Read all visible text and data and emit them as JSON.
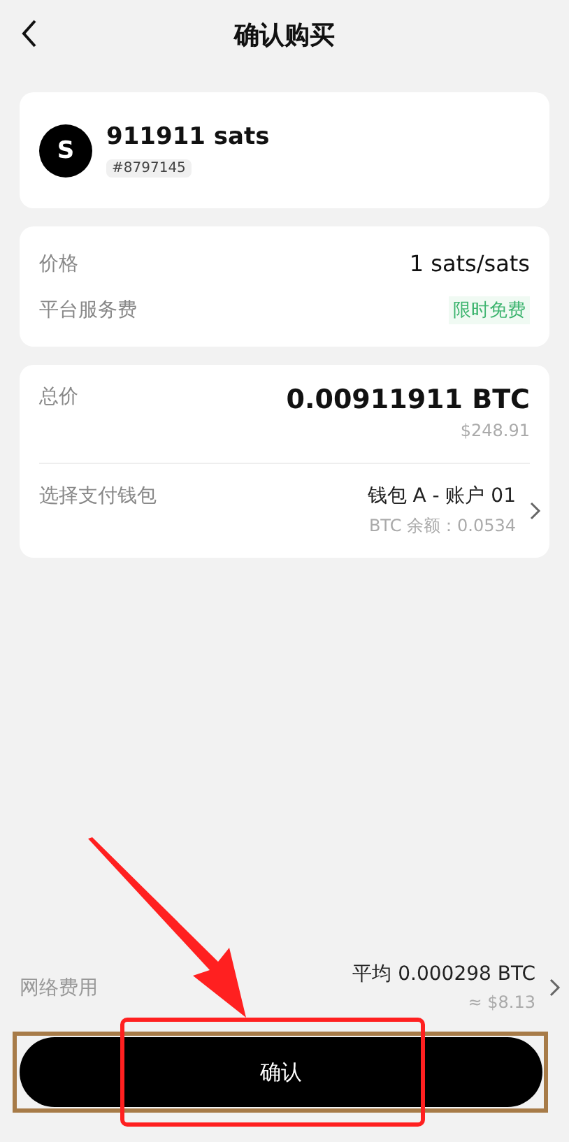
{
  "header": {
    "title": "确认购买"
  },
  "item": {
    "avatar": "S",
    "name": "911911 sats",
    "tag": "#8797145"
  },
  "pricing": [
    {
      "kind": "plain",
      "label": "价格",
      "value": "1 sats/sats"
    },
    {
      "kind": "promo",
      "label": "平台服务费",
      "value": "限时免费"
    }
  ],
  "total": {
    "label": "总价",
    "value": "0.00911911 BTC",
    "fiat": "$248.91"
  },
  "wallet": {
    "label": "选择支付钱包",
    "name": "钱包 A - 账户 01",
    "balance": "BTC 余额：0.0534"
  },
  "network_fee": {
    "label": "网络费用",
    "value": "平均 0.000298 BTC",
    "fiat": "≈ $8.13"
  },
  "confirm_button": "确认"
}
